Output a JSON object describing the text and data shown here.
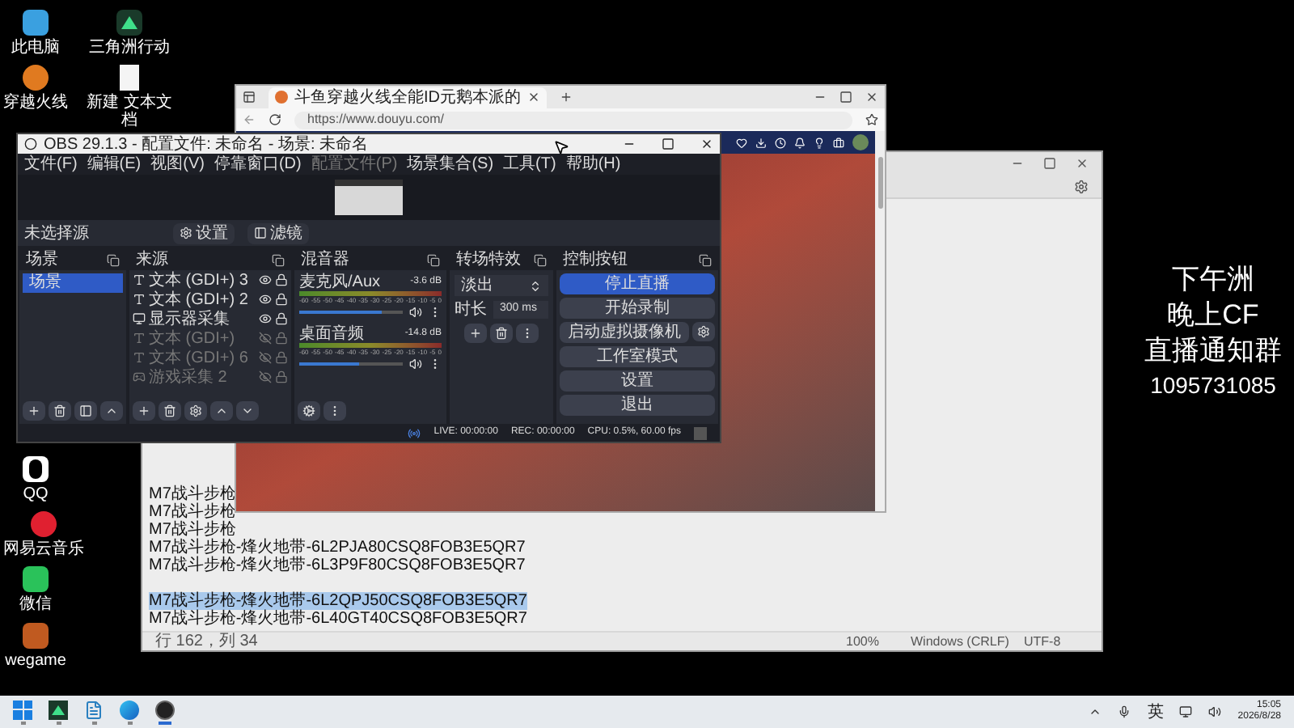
{
  "desktop_icons": [
    {
      "label": "此电脑",
      "kind": "pc"
    },
    {
      "label": "三角洲行动",
      "kind": "triangle"
    },
    {
      "label": "穿越火线",
      "kind": "game"
    },
    {
      "label": "新建 文本文档",
      "kind": "file"
    },
    {
      "label": "QQ",
      "kind": "qq"
    },
    {
      "label": "网易云音乐",
      "kind": "music"
    },
    {
      "label": "微信",
      "kind": "wechat"
    },
    {
      "label": "wegame",
      "kind": "wegame"
    }
  ],
  "overlay_text": [
    "下午洲",
    "晚上CF",
    "直播通知群",
    "1095731085"
  ],
  "notepad": {
    "lines": [
      {
        "kind": "text",
        "text": "M7战斗步枪",
        "selected": false
      },
      {
        "kind": "text",
        "text": "M7战斗步枪",
        "selected": false
      },
      {
        "kind": "text",
        "text": "M7战斗步枪",
        "selected": false
      },
      {
        "kind": "text",
        "text": "M7战斗步枪-烽火地带-6L2PJA80CSQ8FOB3E5QR7",
        "selected": false
      },
      {
        "kind": "text",
        "text": "M7战斗步枪-烽火地带-6L3P9F80CSQ8FOB3E5QR7",
        "selected": false
      },
      {
        "kind": "blank"
      },
      {
        "kind": "text",
        "text": "M7战斗步枪-烽火地带-6L2QPJ50CSQ8FOB3E5QR7",
        "selected": true
      },
      {
        "kind": "text",
        "text": "M7战斗步枪-烽火地带-6L40GT40CSQ8FOB3E5QR7",
        "selected": false
      }
    ],
    "status": {
      "position": "行 162，列 34",
      "zoom": "100%",
      "line_ending": "Windows (CRLF)",
      "encoding": "UTF-8"
    }
  },
  "browser": {
    "tab_title": "斗鱼穿越火线全能ID元鹅本派的",
    "address": "https://www.douyu.com/"
  },
  "obs": {
    "title": "OBS 29.1.3 - 配置文件: 未命名 - 场景: 未命名",
    "menu": [
      {
        "label": "文件(F)",
        "disabled": false
      },
      {
        "label": "编辑(E)",
        "disabled": false
      },
      {
        "label": "视图(V)",
        "disabled": false
      },
      {
        "label": "停靠窗口(D)",
        "disabled": false
      },
      {
        "label": "配置文件(P)",
        "disabled": true
      },
      {
        "label": "场景集合(S)",
        "disabled": false
      },
      {
        "label": "工具(T)",
        "disabled": false
      },
      {
        "label": "帮助(H)",
        "disabled": false
      }
    ],
    "source_status": "未选择源",
    "toolbar_buttons": [
      "设置",
      "滤镜"
    ],
    "scenes_title": "场景",
    "scenes": [
      {
        "name": "场景",
        "selected": true
      }
    ],
    "sources_title": "来源",
    "sources": [
      {
        "name": "文本 (GDI+) 3",
        "kind": "text",
        "visible": true
      },
      {
        "name": "文本 (GDI+) 2",
        "kind": "text",
        "visible": true
      },
      {
        "name": "显示器采集",
        "kind": "monitor",
        "visible": true
      },
      {
        "name": "文本 (GDI+)",
        "kind": "text",
        "visible": false
      },
      {
        "name": "文本 (GDI+) 6",
        "kind": "text",
        "visible": false
      },
      {
        "name": "游戏采集 2",
        "kind": "game",
        "visible": false
      }
    ],
    "mixer_title": "混音器",
    "channels": [
      {
        "name": "麦克风/Aux",
        "reading": "-3.6 dB",
        "level": 0.8,
        "ticks": [
          "-60",
          "-55",
          "-50",
          "-45",
          "-40",
          "-35",
          "-30",
          "-25",
          "-20",
          "-15",
          "-10",
          "-5",
          "0"
        ]
      },
      {
        "name": "桌面音频",
        "reading": "-14.8 dB",
        "level": 0.58,
        "ticks": [
          "-60",
          "-55",
          "-50",
          "-45",
          "-40",
          "-35",
          "-30",
          "-25",
          "-20",
          "-15",
          "-10",
          "-5",
          "0"
        ]
      }
    ],
    "transitions_title": "转场特效",
    "transition": "淡出",
    "duration_label": "时长",
    "duration": "300 ms",
    "controls_title": "控制按钮",
    "controls": [
      {
        "label": "停止直播",
        "active": true,
        "kind": "plain"
      },
      {
        "label": "开始录制",
        "active": false,
        "kind": "plain"
      },
      {
        "label": "启动虚拟摄像机",
        "active": false,
        "kind": "gear"
      },
      {
        "label": "工作室模式",
        "active": false,
        "kind": "plain"
      },
      {
        "label": "设置",
        "active": false,
        "kind": "plain"
      },
      {
        "label": "退出",
        "active": false,
        "kind": "plain"
      }
    ],
    "status": {
      "live": "LIVE: 00:00:00",
      "rec": "REC: 00:00:00",
      "cpu": "CPU: 0.5%, 60.00 fps"
    }
  },
  "taskbar": {
    "apps": [
      {
        "kind": "start",
        "active": false
      },
      {
        "kind": "triangle",
        "active": false
      },
      {
        "kind": "notepad",
        "active": false
      },
      {
        "kind": "edge",
        "active": false
      },
      {
        "kind": "obs",
        "active": true
      }
    ],
    "ime": "英",
    "time": "15:05",
    "date": "2026/8/28"
  }
}
